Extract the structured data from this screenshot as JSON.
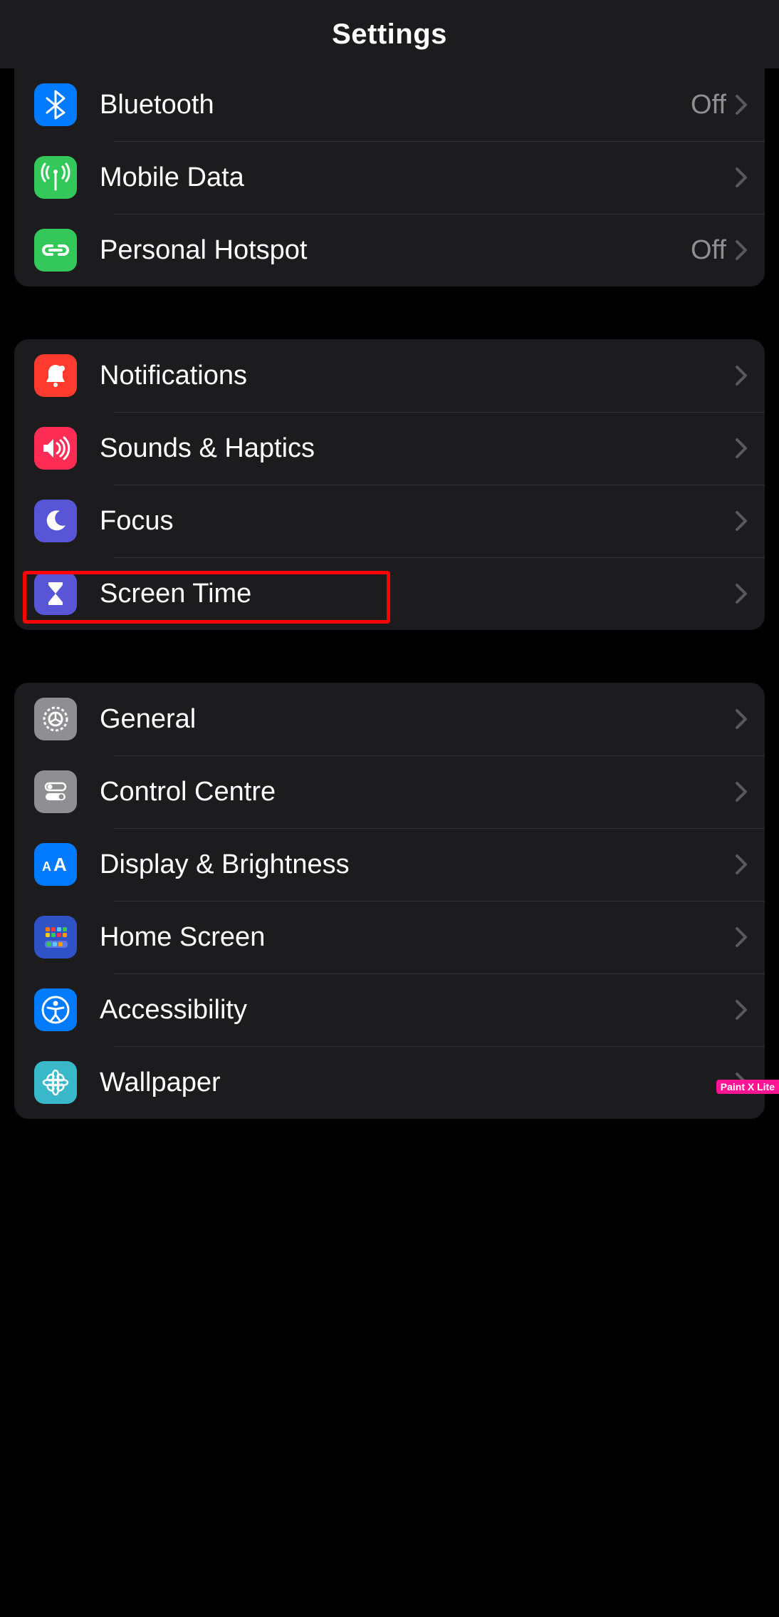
{
  "header": {
    "title": "Settings"
  },
  "groups": [
    {
      "rows": [
        {
          "id": "bluetooth",
          "label": "Bluetooth",
          "status": "Off",
          "icon": "bluetooth",
          "bg": "#007aff"
        },
        {
          "id": "mobile-data",
          "label": "Mobile Data",
          "status": "",
          "icon": "antenna",
          "bg": "#34c759"
        },
        {
          "id": "personal-hotspot",
          "label": "Personal Hotspot",
          "status": "Off",
          "icon": "link",
          "bg": "#34c759"
        }
      ]
    },
    {
      "rows": [
        {
          "id": "notifications",
          "label": "Notifications",
          "status": "",
          "icon": "bell",
          "bg": "#ff3b30"
        },
        {
          "id": "sounds-haptics",
          "label": "Sounds & Haptics",
          "status": "",
          "icon": "speaker",
          "bg": "#ff2d55"
        },
        {
          "id": "focus",
          "label": "Focus",
          "status": "",
          "icon": "moon",
          "bg": "#5856d6"
        },
        {
          "id": "screen-time",
          "label": "Screen Time",
          "status": "",
          "icon": "hourglass",
          "bg": "#5856d6",
          "highlighted": true
        }
      ]
    },
    {
      "rows": [
        {
          "id": "general",
          "label": "General",
          "status": "",
          "icon": "gear",
          "bg": "#8e8e93"
        },
        {
          "id": "control-centre",
          "label": "Control Centre",
          "status": "",
          "icon": "toggles",
          "bg": "#8e8e93"
        },
        {
          "id": "display-brightness",
          "label": "Display & Brightness",
          "status": "",
          "icon": "aa",
          "bg": "#007aff"
        },
        {
          "id": "home-screen",
          "label": "Home Screen",
          "status": "",
          "icon": "grid",
          "bg": "#3355dd"
        },
        {
          "id": "accessibility",
          "label": "Accessibility",
          "status": "",
          "icon": "person-circle",
          "bg": "#007aff"
        },
        {
          "id": "wallpaper",
          "label": "Wallpaper",
          "status": "",
          "icon": "flower",
          "bg": "#38b8c9"
        }
      ]
    }
  ],
  "watermark": "Paint X Lite"
}
